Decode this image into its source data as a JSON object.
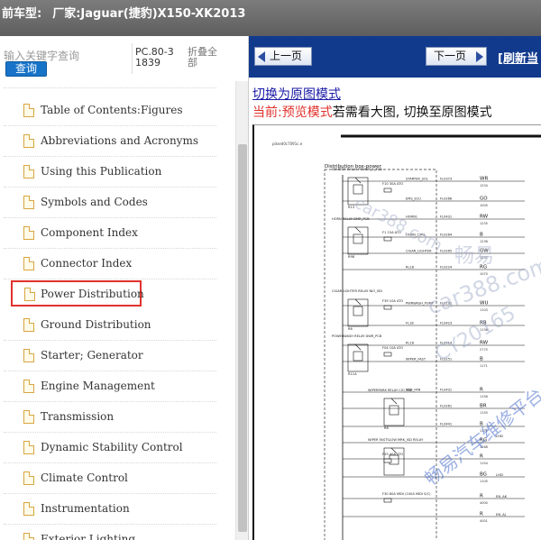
{
  "header": {
    "label": "前车型:",
    "value": "厂家:Jaguar(捷豹)X150-XK2013"
  },
  "sidebar": {
    "search_placeholder": "输入关键字查询",
    "search_button": "查询",
    "doc_code": "PC.80-31839",
    "collapse_all": "折叠全部",
    "items": [
      {
        "label": "Table of Contents:Figures"
      },
      {
        "label": "Abbreviations and Acronyms"
      },
      {
        "label": "Using this Publication"
      },
      {
        "label": "Symbols and Codes"
      },
      {
        "label": "Component Index"
      },
      {
        "label": "Connector Index"
      },
      {
        "label": "Power Distribution",
        "selected": true
      },
      {
        "label": "Ground Distribution"
      },
      {
        "label": "Starter; Generator"
      },
      {
        "label": "Engine Management"
      },
      {
        "label": "Transmission"
      },
      {
        "label": "Dynamic Stability Control"
      },
      {
        "label": "Climate Control"
      },
      {
        "label": "Instrumentation"
      },
      {
        "label": "Exterior Lighting"
      }
    ],
    "icon": "document-icon"
  },
  "viewer": {
    "prev_page": "上一页",
    "next_page": "下一页",
    "refresh": "[刷新当",
    "mode_link": "切换为原图模式",
    "mode_status_prefix": "当前:",
    "mode_status_current": "预览模式",
    "mode_status_suffix": "若需看大图, 切换至原图模式",
    "accent_color": "#113a8d",
    "diagram": {
      "ref": "pdxed0c7091c.e",
      "title": "Distribution box-power",
      "relays": [
        "STARTER RELAY POWER_K_PCB",
        "HORN RELAY DMR_PCB",
        "CIGAR LIGHTER RELAY NIO_ISD",
        "POWERWASH RELAY DWR_PCB",
        "WIPERPARK RELAY CIO_ISD",
        "WIPER FASTSLOW MRK_ISD RELAY"
      ],
      "ids": [
        "R13",
        "R98",
        "R6",
        "R11A",
        "R8"
      ],
      "fuses": [
        "F10 30A ATO",
        "F1 15A ATO",
        "F39 10A ATO",
        "F04 10A ATO",
        "F29 40A ATO",
        "F30 60A MIDI (100A MIDI S/C)"
      ],
      "signals": [
        "STARTER_SOL",
        "EMS_ECU",
        "HORN1",
        "HORN_CTRL",
        "CIGAR_LIGHTER",
        "RL18",
        "PWRWASH_PUMP",
        "FL18",
        "RL18",
        "WIPER_FAST",
        "RAD_FAN"
      ],
      "connectors": [
        "FL0373",
        "FL0266",
        "FL0431",
        "FL0264",
        "FL0265",
        "FL0224",
        "FL0191",
        "FL0423",
        "FL0214",
        "FL0251",
        "FL0431",
        "FL0261",
        "FL0441"
      ],
      "wire_colors": [
        "WR",
        "GO",
        "RW",
        "B",
        "GW",
        "RG",
        "WU",
        "RB",
        "RW",
        "B",
        "R",
        "BR",
        "B",
        "RG",
        "R",
        "BG",
        "R",
        "R"
      ],
      "wire_numbers": [
        "1234",
        "1005",
        "1235",
        "1236",
        "1237",
        "1070",
        "1103",
        "1136",
        "2775",
        "1171",
        "1156",
        "1155",
        "1170",
        "1168",
        "1154",
        "1105",
        "4000",
        "4001"
      ],
      "side_labels": [
        "LHD",
        "LHD",
        "EN_AK",
        "EN_AJ"
      ]
    },
    "watermarks": [
      "car388.com",
      "畅易",
      "car388.com",
      "CY20165",
      "畅易汽车维修平台"
    ]
  }
}
